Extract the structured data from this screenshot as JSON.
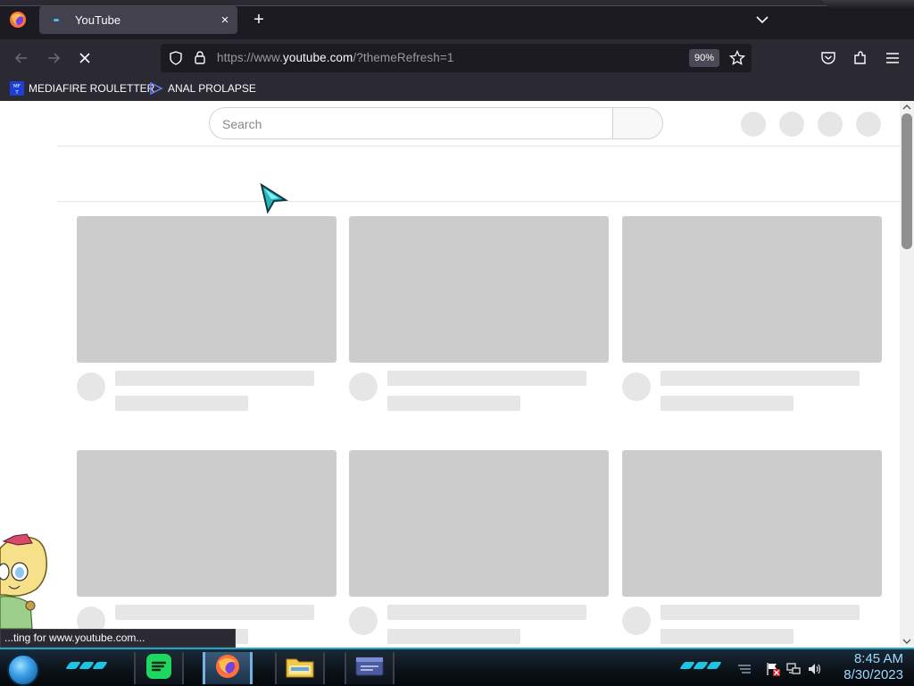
{
  "browser": {
    "tab": {
      "title": "YouTube",
      "close": "×"
    },
    "new_tab": "+",
    "url": {
      "prefix": "https://www.",
      "domain": "youtube.com",
      "suffix": "/?themeRefresh=1"
    },
    "zoom": "90%",
    "bookmarks": [
      {
        "label": "MEDIAFIRE ROULETTER",
        "icon": "mediafire-icon"
      },
      {
        "label": "ANAL PROLAPSE",
        "icon": "bookmark-page-icon"
      }
    ],
    "status": "...ting for www.youtube.com..."
  },
  "page": {
    "search_placeholder": "Search",
    "skeleton_rows": 2,
    "skeleton_cols": 3
  },
  "taskbar": {
    "time": "8:45 AM",
    "date": "8/30/2023",
    "apps": [
      "spotify-icon",
      "firefox-icon",
      "file-explorer-icon",
      "window-app-icon"
    ]
  },
  "colors": {
    "chrome_dark": "#1c1b22",
    "chrome": "#2b2a33",
    "skeleton_thumb": "#cccccc",
    "skeleton_line": "#e6e6e6",
    "taskbar_accent": "#1ea7c9"
  }
}
